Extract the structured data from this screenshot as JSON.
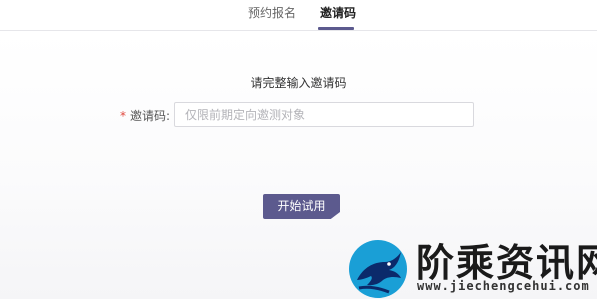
{
  "tabs": [
    {
      "label": "预约报名",
      "active": false
    },
    {
      "label": "邀请码",
      "active": true
    }
  ],
  "form": {
    "title": "请完整输入邀请码",
    "required_mark": "*",
    "invite_label": "邀请码:",
    "invite_placeholder": "仅限前期定向邀测对象",
    "invite_value": ""
  },
  "submit_label": "开始试用",
  "watermark": {
    "name": "阶乘资讯网",
    "url": "www.jiechengcehui.com"
  },
  "colors": {
    "accent": "#5c5a8e",
    "required": "#e0483e",
    "watermark_logo": "#1a9fd6"
  }
}
